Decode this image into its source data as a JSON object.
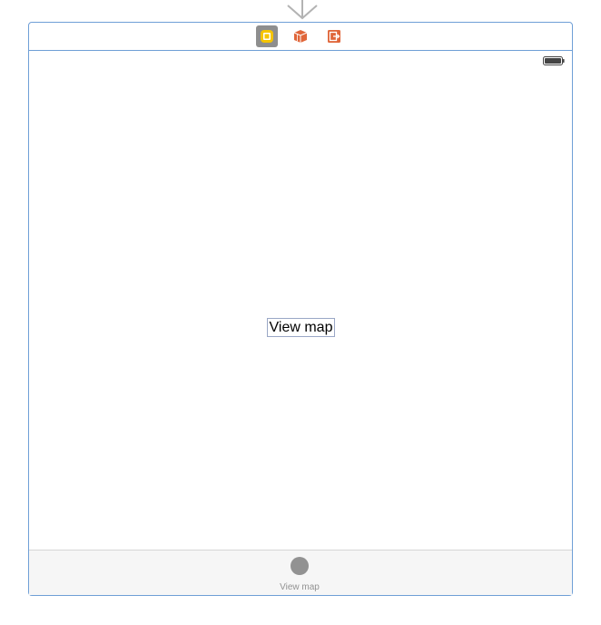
{
  "scene": {
    "dock_icons": [
      {
        "name": "view-controller-icon",
        "color": "#f5c400",
        "selected": true
      },
      {
        "name": "first-responder-icon",
        "color": "#e0663a"
      },
      {
        "name": "exit-icon",
        "color": "#e0663a"
      }
    ]
  },
  "status_bar": {
    "battery_icon": "battery-icon"
  },
  "main": {
    "view_map_button": "View map"
  },
  "tab_bar": {
    "items": [
      {
        "label": "View map",
        "icon": "circle-icon"
      }
    ]
  },
  "colors": {
    "scene_border": "#6f9fd6",
    "tab_inactive": "#929292",
    "tab_bar_bg": "#f6f6f6"
  }
}
